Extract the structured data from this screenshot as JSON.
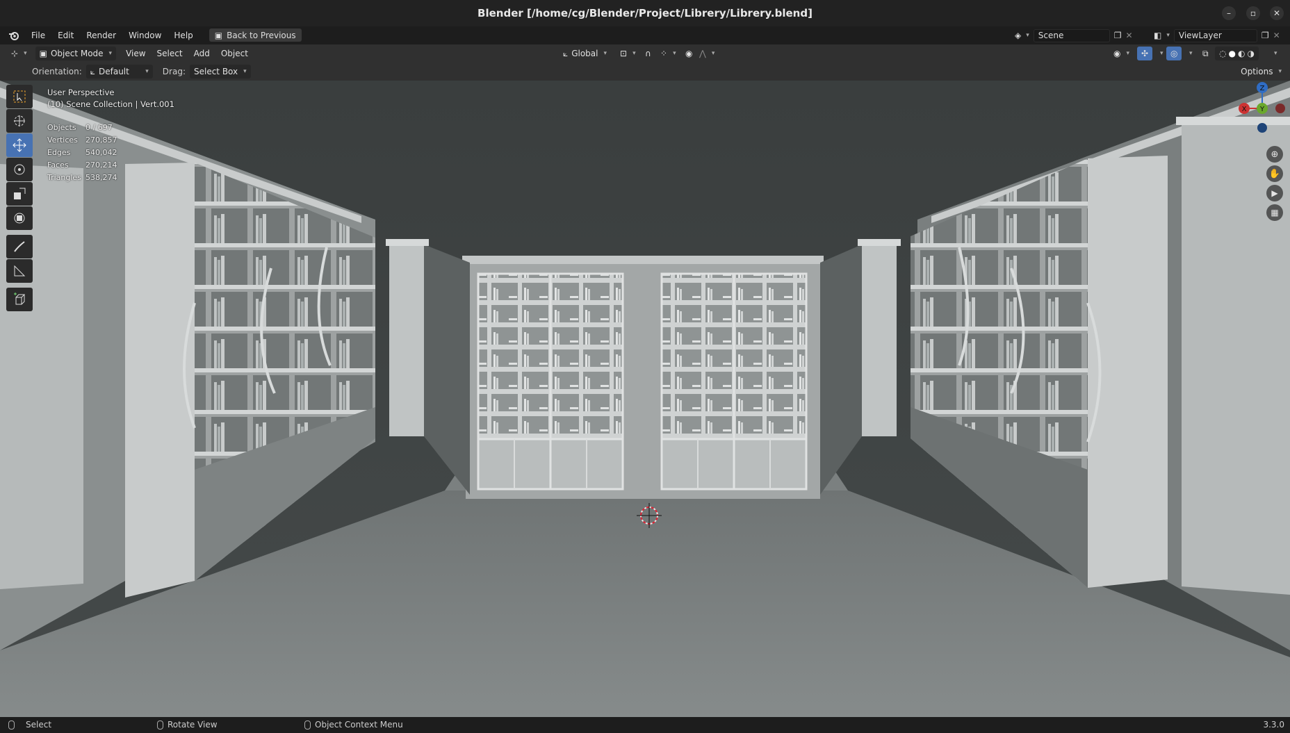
{
  "window": {
    "title": "Blender [/home/cg/Blender/Project/Librery/Librery.blend]"
  },
  "menubar": {
    "items": [
      "File",
      "Edit",
      "Render",
      "Window",
      "Help"
    ],
    "back_button": "Back to Previous",
    "scene": "Scene",
    "view_layer": "ViewLayer"
  },
  "header": {
    "mode": "Object Mode",
    "menus": [
      "View",
      "Select",
      "Add",
      "Object"
    ],
    "transform_orientation": "Global",
    "options": "Options"
  },
  "tool_settings": {
    "orientation_label": "Orientation:",
    "orientation_value": "Default",
    "drag_label": "Drag:",
    "drag_value": "Select Box"
  },
  "viewport": {
    "perspective": "User Perspective",
    "collection": "(10) Scene Collection | Vert.001",
    "stats": [
      {
        "label": "Objects",
        "value": "0 / 697"
      },
      {
        "label": "Vertices",
        "value": "270,857"
      },
      {
        "label": "Edges",
        "value": "540,042"
      },
      {
        "label": "Faces",
        "value": "270,214"
      },
      {
        "label": "Triangles",
        "value": "538,274"
      }
    ],
    "gizmo_axes": [
      "Z",
      "Y",
      "X"
    ]
  },
  "statusbar": {
    "select": "Select",
    "rotate": "Rotate View",
    "context": "Object Context Menu",
    "version": "3.3.0"
  },
  "colors": {
    "accent": "#4772b3",
    "background": "#3e4242",
    "floor": "#7a7f7f"
  }
}
